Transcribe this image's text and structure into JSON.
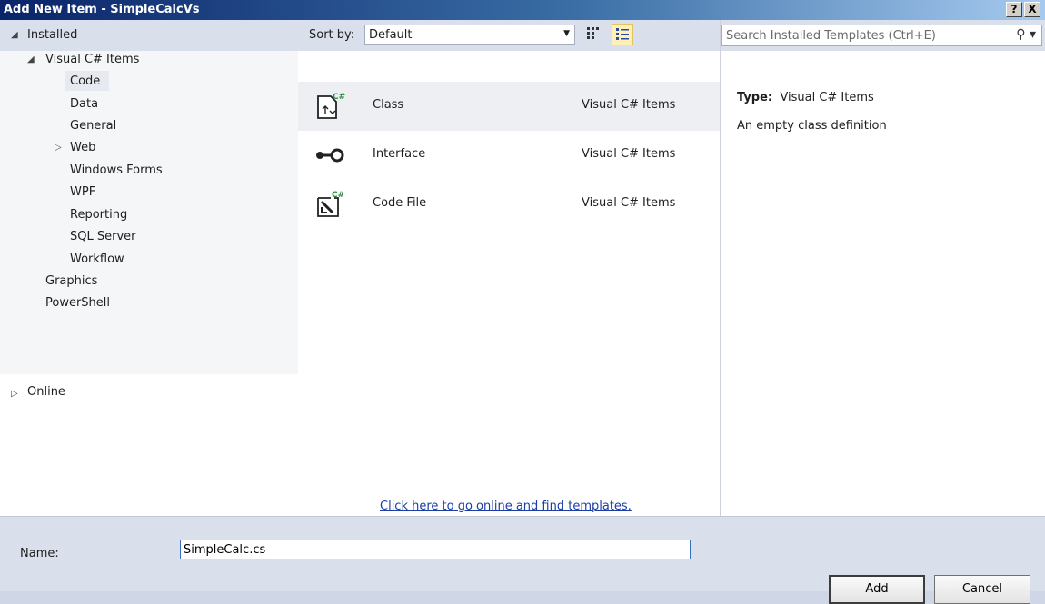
{
  "window": {
    "title": "Add New Item - SimpleCalcVs",
    "help_button": "?",
    "close_button": "X"
  },
  "tree": {
    "installed": "Installed",
    "visual_csharp_items": "Visual C# Items",
    "children": [
      "Code",
      "Data",
      "General",
      "Web",
      "Windows Forms",
      "WPF",
      "Reporting",
      "SQL Server",
      "Workflow"
    ],
    "graphics": "Graphics",
    "powershell": "PowerShell",
    "online": "Online"
  },
  "sort": {
    "label": "Sort by:",
    "selected": "Default"
  },
  "templates": [
    {
      "name": "Class",
      "category": "Visual C# Items"
    },
    {
      "name": "Interface",
      "category": "Visual C# Items"
    },
    {
      "name": "Code File",
      "category": "Visual C# Items"
    }
  ],
  "online_link": "Click here to go online and find templates.",
  "search": {
    "placeholder": "Search Installed Templates (Ctrl+E)"
  },
  "details": {
    "type_label": "Type:",
    "type_value": "Visual C# Items",
    "description": "An empty class definition"
  },
  "bottom": {
    "name_label": "Name:",
    "name_value": "SimpleCalc.cs",
    "add_label": "Add",
    "cancel_label": "Cancel"
  },
  "icons": {
    "csharp_badge": "C#",
    "search_icon": "magnifier",
    "sort_arrow": "chevron-down"
  }
}
